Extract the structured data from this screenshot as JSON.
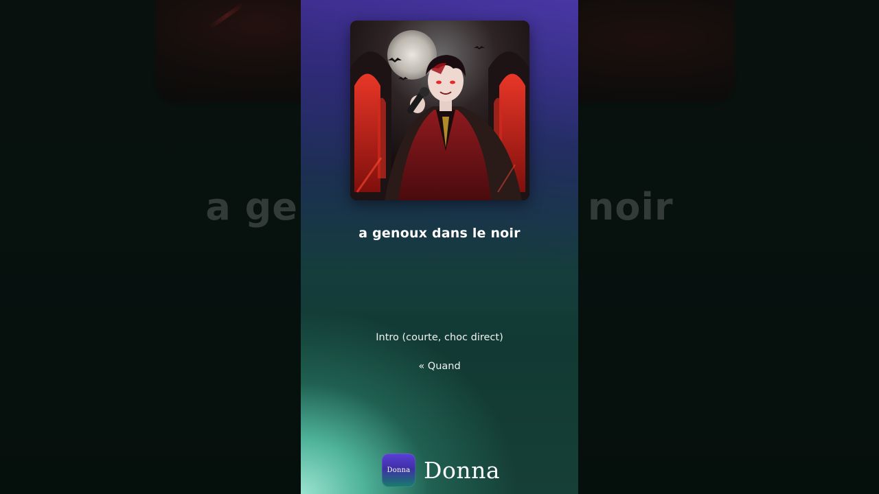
{
  "player": {
    "song_title": "a genoux dans le noir",
    "lyrics": [
      "Intro (courte, choc direct)",
      "« Quand"
    ],
    "cover_art": "gothic-vampire-singer-artwork"
  },
  "background": {
    "blurred_title_left": "a ge",
    "blurred_title_right": "noir"
  },
  "brand": {
    "logo_text": "Donna",
    "name": "Donna"
  },
  "colors": {
    "panel_top": "#3a2a86",
    "panel_bottom_glow": "#9be3cf",
    "text": "#ffffff"
  }
}
